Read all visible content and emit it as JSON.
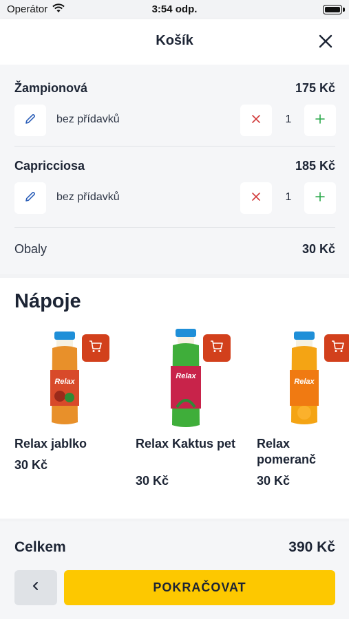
{
  "status_bar": {
    "carrier": "Operátor",
    "time": "3:54 odp."
  },
  "header": {
    "title": "Košík"
  },
  "cart": {
    "items": [
      {
        "name": "Žampionová",
        "price": "175 Kč",
        "extras": "bez přídavků",
        "quantity": "1"
      },
      {
        "name": "Capricciosa",
        "price": "185 Kč",
        "extras": "bez přídavků",
        "quantity": "1"
      }
    ],
    "packaging": {
      "label": "Obaly",
      "price": "30 Kč"
    }
  },
  "drinks": {
    "title": "Nápoje",
    "products": [
      {
        "name": "Relax jablko",
        "price": "30 Kč",
        "label_text": "Relax",
        "liquid_color": "#e8902a",
        "body_color": "#d84a2a"
      },
      {
        "name": "Relax Kaktus pet",
        "price": "30 Kč",
        "label_text": "Relax",
        "liquid_color": "#3fae3a",
        "body_color": "#c8234a"
      },
      {
        "name": "Relax pomeranč",
        "price": "30 Kč",
        "label_text": "Relax",
        "liquid_color": "#f4a414",
        "body_color": "#f07a12"
      }
    ]
  },
  "footer": {
    "total_label": "Celkem",
    "total_value": "390 Kč",
    "continue_label": "POKRAČOVAT"
  },
  "colors": {
    "accent_yellow": "#fdc800",
    "cart_button": "#d2401c",
    "remove_red": "#d23a3a",
    "add_green": "#2aa84a",
    "edit_blue": "#2c5fb8"
  }
}
